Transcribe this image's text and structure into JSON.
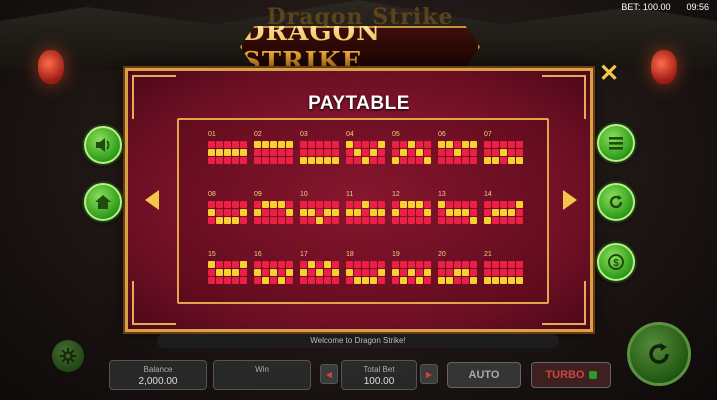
{
  "status": {
    "bet_label": "BET: 100.00",
    "time": "09:56"
  },
  "background": {
    "title_text": "Dragon Strike"
  },
  "logo": {
    "text": "DRAGON STRIKE"
  },
  "paytable": {
    "title": "PAYTABLE",
    "lines": [
      {
        "num": "01",
        "pattern": [
          0,
          0,
          0,
          0,
          0,
          1,
          1,
          1,
          1,
          1,
          0,
          0,
          0,
          0,
          0
        ]
      },
      {
        "num": "02",
        "pattern": [
          1,
          1,
          1,
          1,
          1,
          0,
          0,
          0,
          0,
          0,
          0,
          0,
          0,
          0,
          0
        ]
      },
      {
        "num": "03",
        "pattern": [
          0,
          0,
          0,
          0,
          0,
          0,
          0,
          0,
          0,
          0,
          1,
          1,
          1,
          1,
          1
        ]
      },
      {
        "num": "04",
        "pattern": [
          1,
          0,
          0,
          0,
          1,
          0,
          1,
          0,
          1,
          0,
          0,
          0,
          1,
          0,
          0
        ]
      },
      {
        "num": "05",
        "pattern": [
          0,
          0,
          1,
          0,
          0,
          0,
          1,
          0,
          1,
          0,
          1,
          0,
          0,
          0,
          1
        ]
      },
      {
        "num": "06",
        "pattern": [
          1,
          1,
          0,
          1,
          1,
          0,
          0,
          1,
          0,
          0,
          0,
          0,
          0,
          0,
          0
        ]
      },
      {
        "num": "07",
        "pattern": [
          0,
          0,
          0,
          0,
          0,
          0,
          0,
          1,
          0,
          0,
          1,
          1,
          0,
          1,
          1
        ]
      },
      {
        "num": "08",
        "pattern": [
          0,
          0,
          0,
          0,
          0,
          1,
          0,
          0,
          0,
          1,
          0,
          1,
          1,
          1,
          0
        ]
      },
      {
        "num": "09",
        "pattern": [
          0,
          1,
          1,
          1,
          0,
          1,
          0,
          0,
          0,
          1,
          0,
          0,
          0,
          0,
          0
        ]
      },
      {
        "num": "10",
        "pattern": [
          0,
          0,
          0,
          0,
          0,
          1,
          1,
          0,
          1,
          1,
          0,
          0,
          1,
          0,
          0
        ]
      },
      {
        "num": "11",
        "pattern": [
          0,
          0,
          1,
          0,
          0,
          1,
          1,
          0,
          1,
          1,
          0,
          0,
          0,
          0,
          0
        ]
      },
      {
        "num": "12",
        "pattern": [
          0,
          1,
          1,
          1,
          0,
          1,
          0,
          0,
          0,
          1,
          0,
          0,
          0,
          0,
          0
        ]
      },
      {
        "num": "13",
        "pattern": [
          1,
          0,
          0,
          0,
          0,
          0,
          1,
          1,
          1,
          0,
          0,
          0,
          0,
          0,
          1
        ]
      },
      {
        "num": "14",
        "pattern": [
          0,
          0,
          0,
          0,
          1,
          0,
          1,
          1,
          1,
          0,
          1,
          0,
          0,
          0,
          0
        ]
      },
      {
        "num": "15",
        "pattern": [
          1,
          0,
          0,
          0,
          1,
          0,
          1,
          1,
          1,
          0,
          0,
          0,
          0,
          0,
          0
        ]
      },
      {
        "num": "16",
        "pattern": [
          0,
          0,
          0,
          0,
          0,
          1,
          0,
          1,
          0,
          1,
          0,
          1,
          0,
          1,
          0
        ]
      },
      {
        "num": "17",
        "pattern": [
          0,
          1,
          0,
          1,
          0,
          1,
          0,
          1,
          0,
          1,
          0,
          0,
          0,
          0,
          0
        ]
      },
      {
        "num": "18",
        "pattern": [
          0,
          0,
          0,
          0,
          0,
          1,
          0,
          0,
          0,
          1,
          0,
          1,
          1,
          1,
          0
        ]
      },
      {
        "num": "19",
        "pattern": [
          0,
          0,
          0,
          0,
          0,
          1,
          0,
          1,
          0,
          1,
          0,
          1,
          0,
          1,
          0
        ]
      },
      {
        "num": "20",
        "pattern": [
          0,
          0,
          0,
          0,
          0,
          0,
          0,
          1,
          1,
          0,
          1,
          1,
          0,
          0,
          1
        ]
      },
      {
        "num": "21",
        "pattern": [
          0,
          0,
          0,
          0,
          0,
          0,
          0,
          0,
          0,
          0,
          1,
          1,
          1,
          1,
          1
        ]
      }
    ]
  },
  "side_buttons": {
    "left": [
      {
        "icon": "speaker-icon"
      },
      {
        "icon": "home-icon"
      }
    ],
    "right": [
      {
        "icon": "menu-icon"
      },
      {
        "icon": "refresh-icon"
      },
      {
        "icon": "coin-icon"
      }
    ]
  },
  "footer": {
    "ticker": "Welcome to Dragon Strike!",
    "balance_label": "Balance",
    "balance_value": "2,000.00",
    "win_label": "Win",
    "win_value": "",
    "total_bet_label": "Total Bet",
    "total_bet_value": "100.00",
    "auto_label": "AUTO",
    "turbo_label": "TURBO"
  },
  "colors": {
    "panel": "#8a1530",
    "gold": "#d9a04a",
    "cell_off": "#ee1f45",
    "cell_on": "#f9d12c",
    "button_green": "#2f9a1a"
  }
}
